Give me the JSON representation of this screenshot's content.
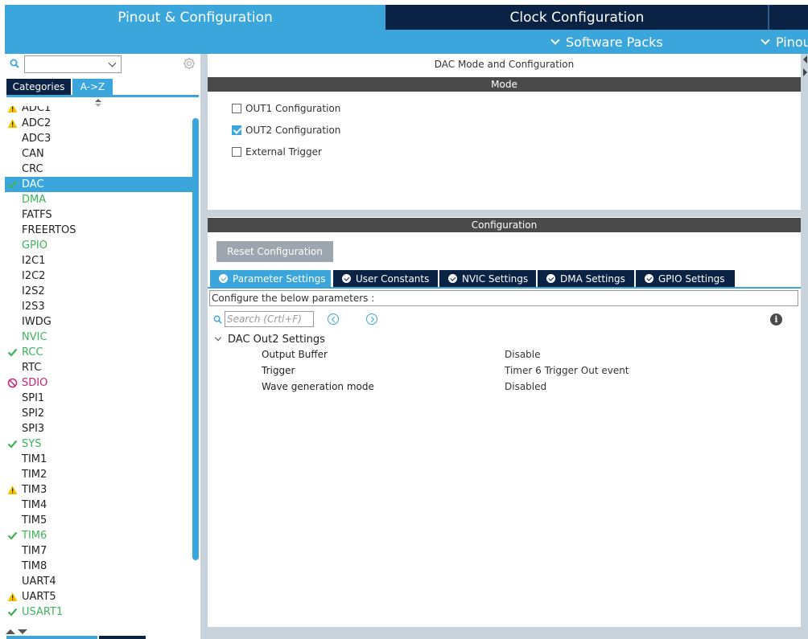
{
  "header": {
    "tab_pinout": "Pinout & Configuration",
    "tab_clock": "Clock Configuration",
    "software_packs": "Software Packs",
    "pinout": "Pinout"
  },
  "left": {
    "search_value": "",
    "tabs": {
      "categories": "Categories",
      "az": "A->Z"
    },
    "items": [
      {
        "label": "ADC1",
        "status": "warn",
        "color": "normal"
      },
      {
        "label": "ADC2",
        "status": "warn",
        "color": "normal"
      },
      {
        "label": "ADC3",
        "status": "",
        "color": "normal"
      },
      {
        "label": "CAN",
        "status": "",
        "color": "normal"
      },
      {
        "label": "CRC",
        "status": "",
        "color": "normal"
      },
      {
        "label": "DAC",
        "status": "check",
        "color": "green",
        "selected": true
      },
      {
        "label": "DMA",
        "status": "",
        "color": "green"
      },
      {
        "label": "FATFS",
        "status": "",
        "color": "normal"
      },
      {
        "label": "FREERTOS",
        "status": "",
        "color": "normal"
      },
      {
        "label": "GPIO",
        "status": "",
        "color": "green"
      },
      {
        "label": "I2C1",
        "status": "",
        "color": "normal"
      },
      {
        "label": "I2C2",
        "status": "",
        "color": "normal"
      },
      {
        "label": "I2S2",
        "status": "",
        "color": "normal"
      },
      {
        "label": "I2S3",
        "status": "",
        "color": "normal"
      },
      {
        "label": "IWDG",
        "status": "",
        "color": "normal"
      },
      {
        "label": "NVIC",
        "status": "",
        "color": "green"
      },
      {
        "label": "RCC",
        "status": "check",
        "color": "green"
      },
      {
        "label": "RTC",
        "status": "",
        "color": "normal"
      },
      {
        "label": "SDIO",
        "status": "disabled",
        "color": "magenta"
      },
      {
        "label": "SPI1",
        "status": "",
        "color": "normal"
      },
      {
        "label": "SPI2",
        "status": "",
        "color": "normal"
      },
      {
        "label": "SPI3",
        "status": "",
        "color": "normal"
      },
      {
        "label": "SYS",
        "status": "check",
        "color": "green"
      },
      {
        "label": "TIM1",
        "status": "",
        "color": "normal"
      },
      {
        "label": "TIM2",
        "status": "",
        "color": "normal"
      },
      {
        "label": "TIM3",
        "status": "warn",
        "color": "normal"
      },
      {
        "label": "TIM4",
        "status": "",
        "color": "normal"
      },
      {
        "label": "TIM5",
        "status": "",
        "color": "normal"
      },
      {
        "label": "TIM6",
        "status": "check",
        "color": "green"
      },
      {
        "label": "TIM7",
        "status": "",
        "color": "normal"
      },
      {
        "label": "TIM8",
        "status": "",
        "color": "normal"
      },
      {
        "label": "UART4",
        "status": "",
        "color": "normal"
      },
      {
        "label": "UART5",
        "status": "warn",
        "color": "normal"
      },
      {
        "label": "USART1",
        "status": "check",
        "color": "green"
      }
    ]
  },
  "main": {
    "title": "DAC Mode and Configuration",
    "mode_header": "Mode",
    "mode_options": [
      {
        "label": "OUT1 Configuration",
        "checked": false
      },
      {
        "label": "OUT2 Configuration",
        "checked": true
      },
      {
        "label": "External Trigger",
        "checked": false
      }
    ],
    "config_header": "Configuration",
    "reset_button": "Reset Configuration",
    "tabs": [
      {
        "label": "Parameter Settings",
        "active": true
      },
      {
        "label": "User Constants",
        "active": false
      },
      {
        "label": "NVIC Settings",
        "active": false
      },
      {
        "label": "DMA Settings",
        "active": false
      },
      {
        "label": "GPIO Settings",
        "active": false
      }
    ],
    "configure_text": "Configure the below parameters :",
    "search_placeholder": "Search (Crtl+F)",
    "group_title": "DAC Out2 Settings",
    "params": [
      {
        "name": "Output Buffer",
        "value": "Disable"
      },
      {
        "name": "Trigger",
        "value": "Timer 6 Trigger Out event"
      },
      {
        "name": "Wave generation mode",
        "value": "Disabled"
      }
    ]
  },
  "colors": {
    "accent": "#3aa6db",
    "navy": "#0a2244",
    "dark_bar": "#4a4a4a",
    "green": "#3cb35a",
    "warning": "#f5c400",
    "disabled": "#c5257a"
  },
  "icons": {
    "status_warn": "warning-icon",
    "status_check": "check-icon",
    "status_disabled": "disabled-icon"
  }
}
